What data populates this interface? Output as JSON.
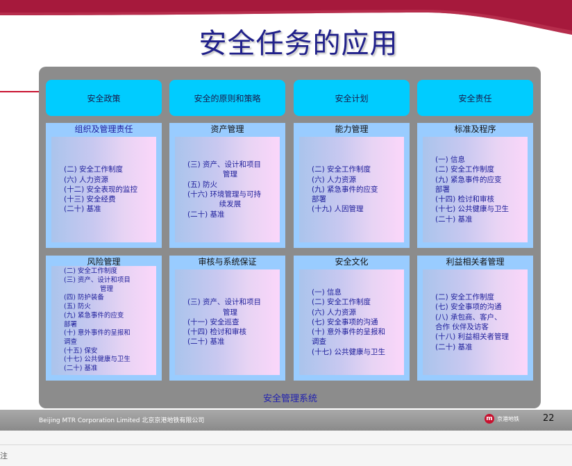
{
  "slide": {
    "title": "安全任务的应用",
    "headers": [
      "安全政策",
      "安全的原则和策略",
      "安全计划",
      "安全责任"
    ],
    "cards": [
      {
        "title": "组织及管理责任",
        "items": [
          "(二) 安全工作制度",
          "(六) 人力资源",
          "(十二) 安全表现的监控",
          "(十三) 安全经费",
          "(二十) 基准"
        ]
      },
      {
        "title": "资产管理",
        "items": [
          "(三) 资产、设计和项目",
          "管理",
          "(五) 防火",
          "(十六) 环境管理与可持",
          "续发展",
          "(二十) 基准"
        ]
      },
      {
        "title": "能力管理",
        "items": [
          "(二) 安全工作制度",
          "(六) 人力资源",
          "(九) 紧急事件的应变",
          "部署",
          "(十九) 人因管理"
        ]
      },
      {
        "title": "标准及程序",
        "items": [
          "(一) 信息",
          "(二) 安全工作制度",
          "(九) 紧急事件的应变",
          "部署",
          "(十四) 检讨和审核",
          "(十七) 公共健康与卫生",
          "(二十) 基准"
        ]
      },
      {
        "title": "风险管理",
        "items": [
          "(二) 安全工作制度",
          "(三) 资产、设计和项目",
          "管理",
          "(四) 防护装备",
          "(五) 防火",
          "(九) 紧急事件的应变",
          "部署",
          "(十) 意外事件的呈报和",
          "调查",
          "(十五) 保安",
          "(十七) 公共健康与卫生",
          "(二十) 基准"
        ]
      },
      {
        "title": "审核与系统保证",
        "items": [
          "(三) 资产、设计和项目",
          "管理",
          "(十一) 安全巡查",
          "(十四) 检讨和审核",
          "(二十) 基准"
        ]
      },
      {
        "title": "安全文化",
        "items": [
          "(一) 信息",
          "(二) 安全工作制度",
          "(六) 人力资源",
          "(七) 安全事项的沟通",
          "(十) 意外事件的呈报和",
          "调查",
          "(十七) 公共健康与卫生"
        ]
      },
      {
        "title": "利益相关者管理",
        "items": [
          "(二) 安全工作制度",
          "(七) 安全事项的沟通",
          "(八) 承包商、客户、",
          "合作 伙伴及访客",
          "(十八) 利益相关者管理",
          "(二十) 基准"
        ]
      }
    ],
    "system_label": "安全管理系统"
  },
  "footer": {
    "company": "Beijing MTR Corporation Limited 北京京港地铁有限公司",
    "brand_logo": "m",
    "brand_text": "京港地铁",
    "page_number": "22"
  },
  "status_bar": {
    "glyph": "注"
  },
  "colors": {
    "brand_red": "#a6193c",
    "header_cyan": "#00ccff",
    "card_blue": "#99ccff",
    "title_navy": "#20208a",
    "panel_gray": "#8c8c8c"
  }
}
